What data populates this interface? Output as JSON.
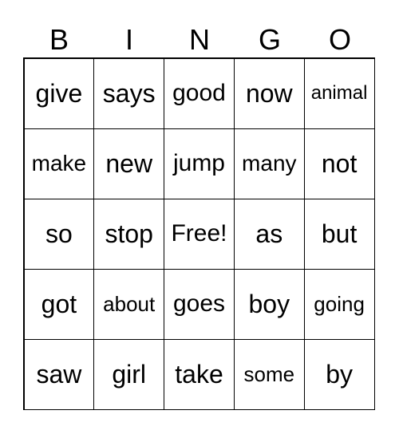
{
  "header": [
    "B",
    "I",
    "N",
    "G",
    "O"
  ],
  "cells": [
    [
      "give",
      "says",
      "good",
      "now",
      "animal"
    ],
    [
      "make",
      "new",
      "jump",
      "many",
      "not"
    ],
    [
      "so",
      "stop",
      "Free!",
      "as",
      "but"
    ],
    [
      "got",
      "about",
      "goes",
      "boy",
      "going"
    ],
    [
      "saw",
      "girl",
      "take",
      "some",
      "by"
    ]
  ]
}
